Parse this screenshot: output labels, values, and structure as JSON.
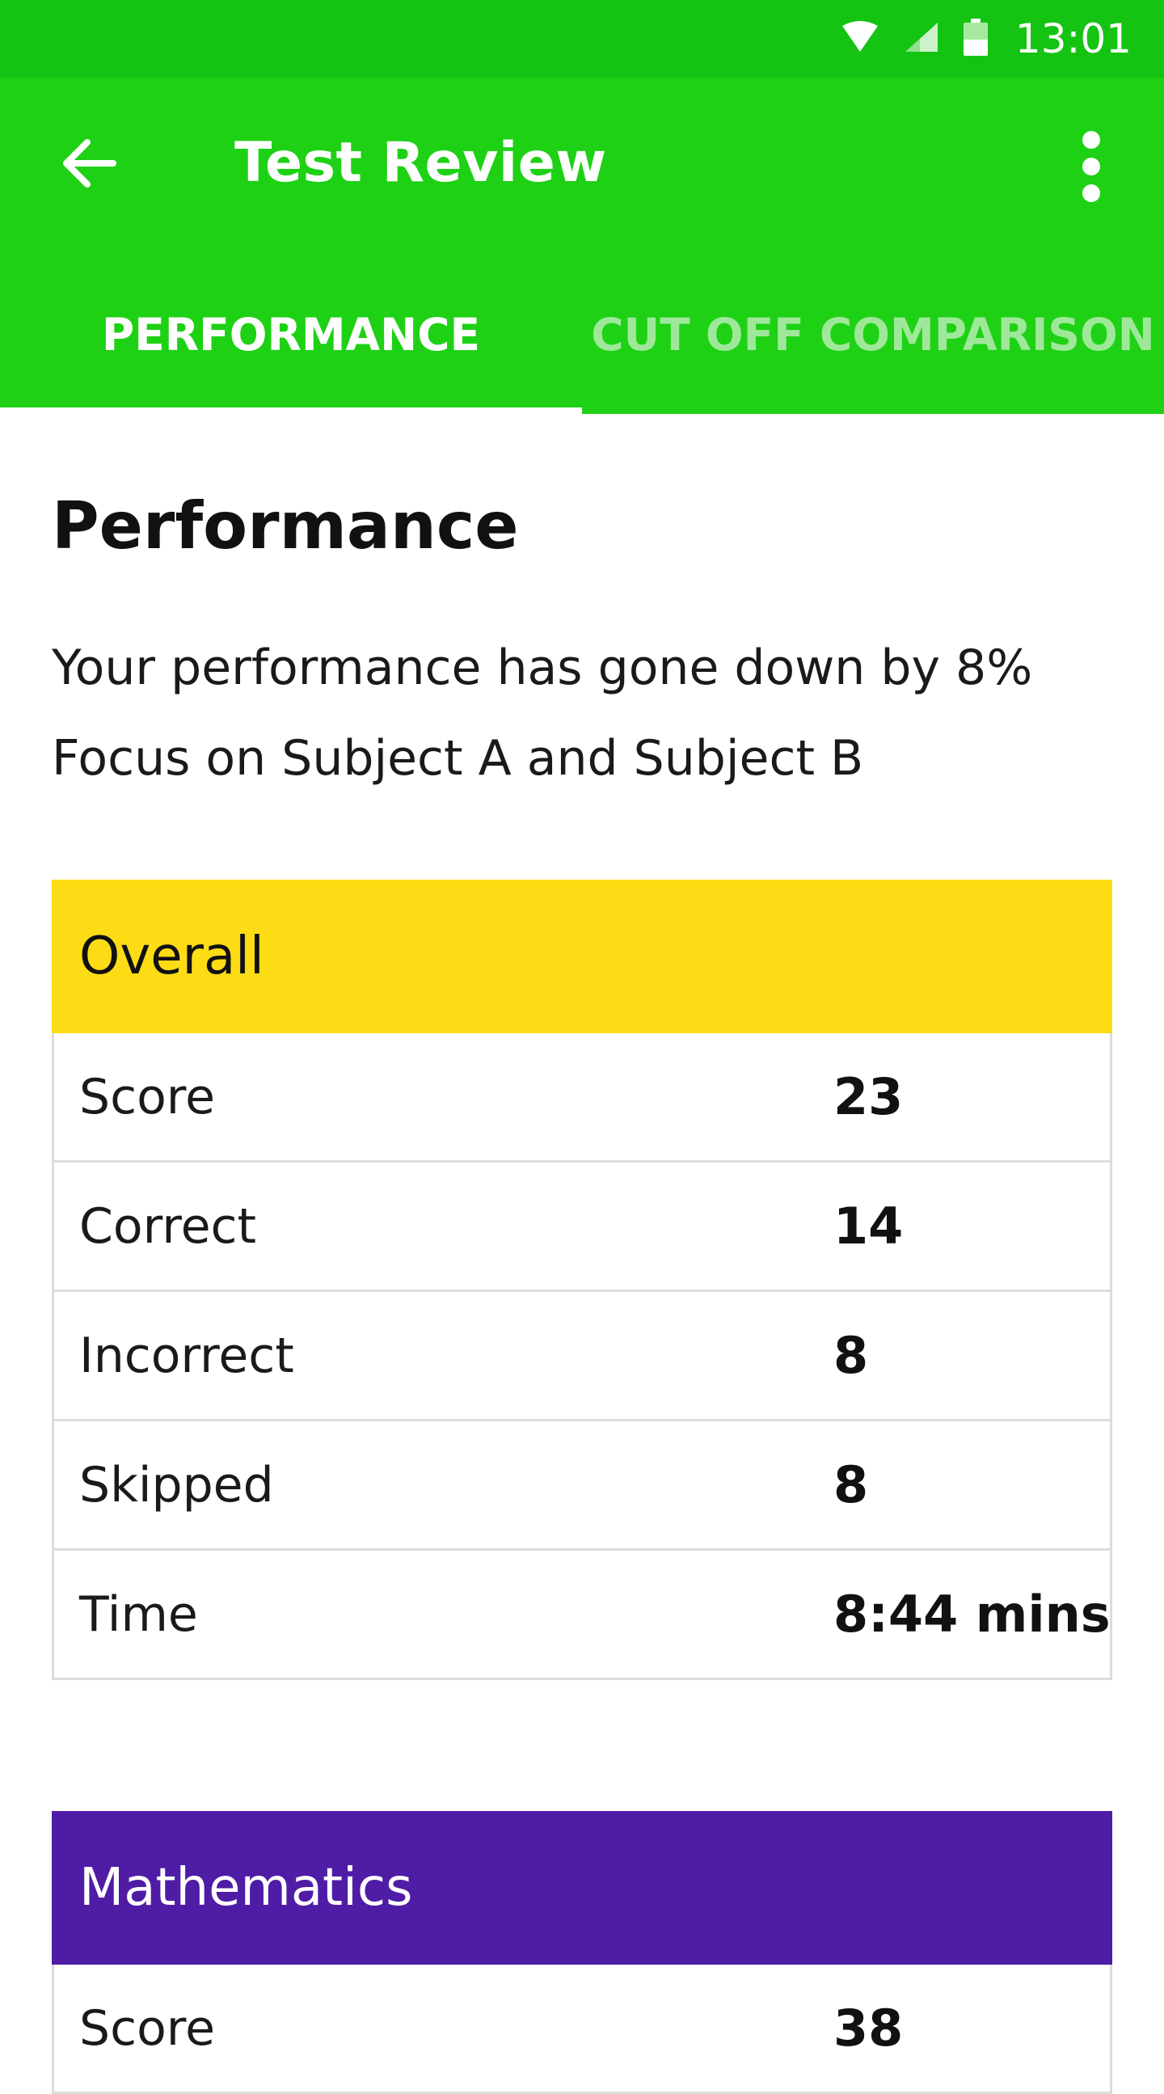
{
  "status_bar": {
    "time": "13:01",
    "icons": [
      "wifi-icon",
      "cell-signal-icon",
      "battery-icon"
    ]
  },
  "app_bar": {
    "title": "Test Review",
    "back_icon": "arrow-back-icon",
    "more_icon": "more-vert-icon"
  },
  "tabs": [
    {
      "label": "PERFORMANCE",
      "selected": true
    },
    {
      "label": "CUT OFF COMPARISON",
      "selected": false
    }
  ],
  "section": {
    "title": "Performance",
    "summary_lines": [
      "Your performance has gone down by 8%",
      "Focus on Subject A and Subject B"
    ]
  },
  "cards": [
    {
      "title": "Overall",
      "header_color": "#fddc16",
      "header_text_color": "#111111",
      "rows": [
        {
          "label": "Score",
          "value": "23"
        },
        {
          "label": "Correct",
          "value": "14"
        },
        {
          "label": "Incorrect",
          "value": "8"
        },
        {
          "label": "Skipped",
          "value": "8"
        },
        {
          "label": "Time",
          "value": "8:44 mins"
        }
      ]
    },
    {
      "title": "Mathematics",
      "header_color": "#4f1ca6",
      "header_text_color": "#ffffff",
      "rows": [
        {
          "label": "Score",
          "value": "38"
        }
      ]
    }
  ],
  "colors": {
    "status_bar": "#15c313",
    "app_bar": "#1ed115",
    "tab_inactive_text": "#9fe89a"
  }
}
